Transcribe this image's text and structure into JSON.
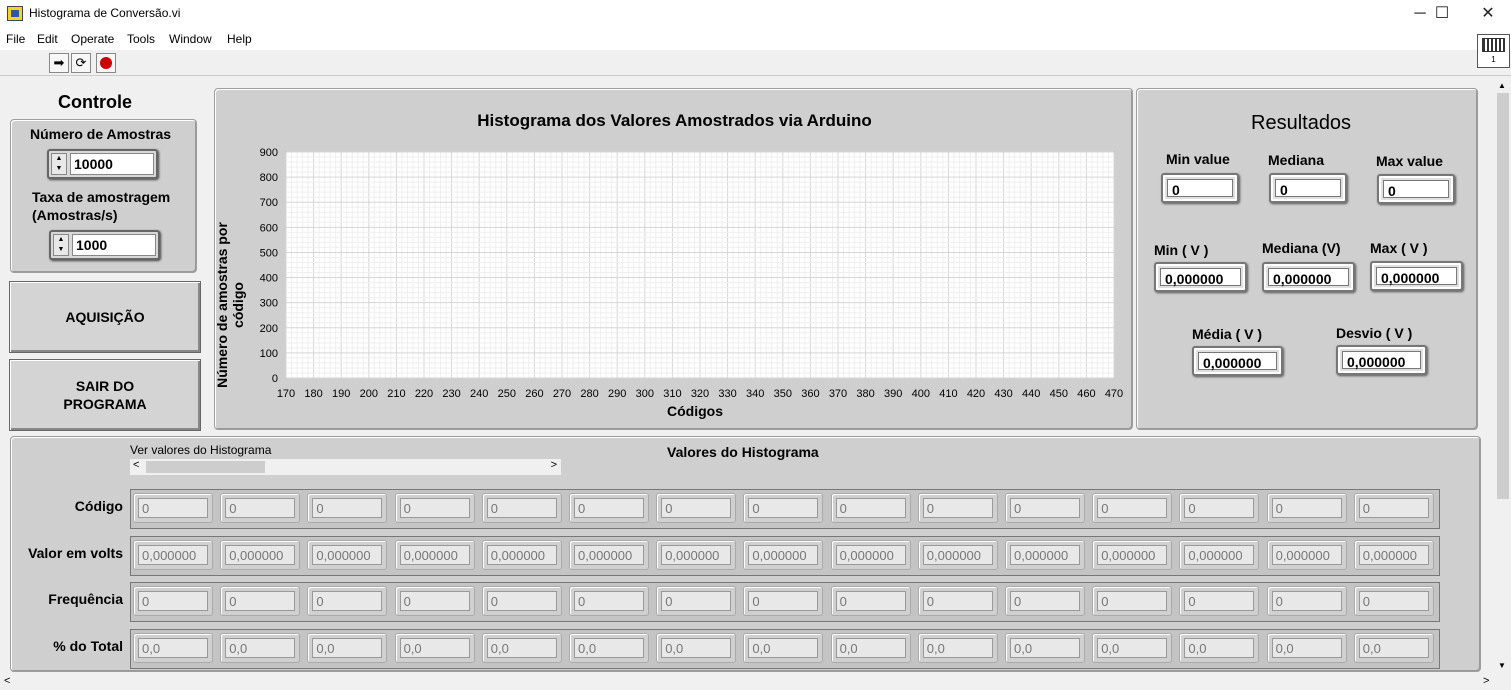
{
  "window": {
    "title": "Histograma de Conversão.vi",
    "min": "─",
    "max": "☐",
    "close": "✕"
  },
  "menu": [
    "File",
    "Edit",
    "Operate",
    "Tools",
    "Window",
    "Help"
  ],
  "toolbar": {
    "run_icon": "run-arrow-icon",
    "cont_icon": "run-continuous-icon",
    "abort_icon": "abort-icon",
    "run_ind_label": "1"
  },
  "control": {
    "title": "Controle",
    "samples_label": "Número de Amostras",
    "samples_value": "10000",
    "rate_label": "Taxa de amostragem (Amostras/s)",
    "rate_value": "1000"
  },
  "buttons": {
    "acquire": "AQUISIÇÃO",
    "exit": "SAIR DO PROGRAMA"
  },
  "chart_data": {
    "type": "bar",
    "title": "Histograma dos Valores Amostrados via Arduino",
    "xlabel": "Códigos",
    "ylabel": "Número de amostras  por código",
    "xlim": [
      170,
      470
    ],
    "ylim": [
      0,
      900
    ],
    "x_ticks": [
      170,
      180,
      190,
      200,
      210,
      220,
      230,
      240,
      250,
      260,
      270,
      280,
      290,
      300,
      310,
      320,
      330,
      340,
      350,
      360,
      370,
      380,
      390,
      400,
      410,
      420,
      430,
      440,
      450,
      460,
      470
    ],
    "y_ticks": [
      0,
      100,
      200,
      300,
      400,
      500,
      600,
      700,
      800,
      900
    ],
    "grid": true,
    "values": []
  },
  "results": {
    "title": "Resultados",
    "min_value_label": "Min value",
    "min_value": "0",
    "median_label": "Mediana",
    "median": "0",
    "max_value_label": "Max value",
    "max_value": "0",
    "min_v_label": "Min ( V )",
    "min_v": "0,000000",
    "median_v_label": "Mediana (V)",
    "median_v": "0,000000",
    "max_v_label": "Max ( V )",
    "max_v": "0,000000",
    "mean_label": "Média ( V )",
    "mean": "0,000000",
    "std_label": "Desvio ( V )",
    "std": "0,000000"
  },
  "histogram": {
    "title": "Valores do Histograma",
    "scroll_label": "Ver valores do Histograma",
    "rows": [
      {
        "label": "Código",
        "values": [
          "0",
          "0",
          "0",
          "0",
          "0",
          "0",
          "0",
          "0",
          "0",
          "0",
          "0",
          "0",
          "0",
          "0",
          "0"
        ]
      },
      {
        "label": "Valor em volts",
        "values": [
          "0,000000",
          "0,000000",
          "0,000000",
          "0,000000",
          "0,000000",
          "0,000000",
          "0,000000",
          "0,000000",
          "0,000000",
          "0,000000",
          "0,000000",
          "0,000000",
          "0,000000",
          "0,000000",
          "0,000000"
        ]
      },
      {
        "label": "Frequência",
        "values": [
          "0",
          "0",
          "0",
          "0",
          "0",
          "0",
          "0",
          "0",
          "0",
          "0",
          "0",
          "0",
          "0",
          "0",
          "0"
        ]
      },
      {
        "label": "% do Total",
        "values": [
          "0,0",
          "0,0",
          "0,0",
          "0,0",
          "0,0",
          "0,0",
          "0,0",
          "0,0",
          "0,0",
          "0,0",
          "0,0",
          "0,0",
          "0,0",
          "0,0",
          "0,0"
        ]
      }
    ]
  }
}
